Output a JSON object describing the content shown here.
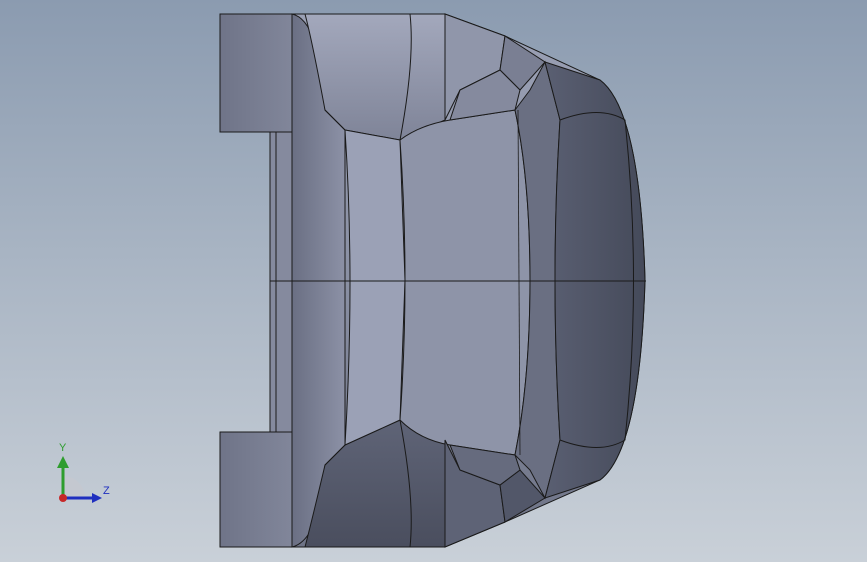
{
  "viewport": {
    "background_top": "#8b9bb0",
    "background_bottom": "#c9d0d8"
  },
  "model": {
    "face_color": "#7d8296",
    "edge_color": "#1a1a1a"
  },
  "triad": {
    "y_label": "Y",
    "z_label": "Z",
    "y_color": "#2e9d2e",
    "z_color": "#1f2fbf",
    "origin_color": "#c62828"
  }
}
